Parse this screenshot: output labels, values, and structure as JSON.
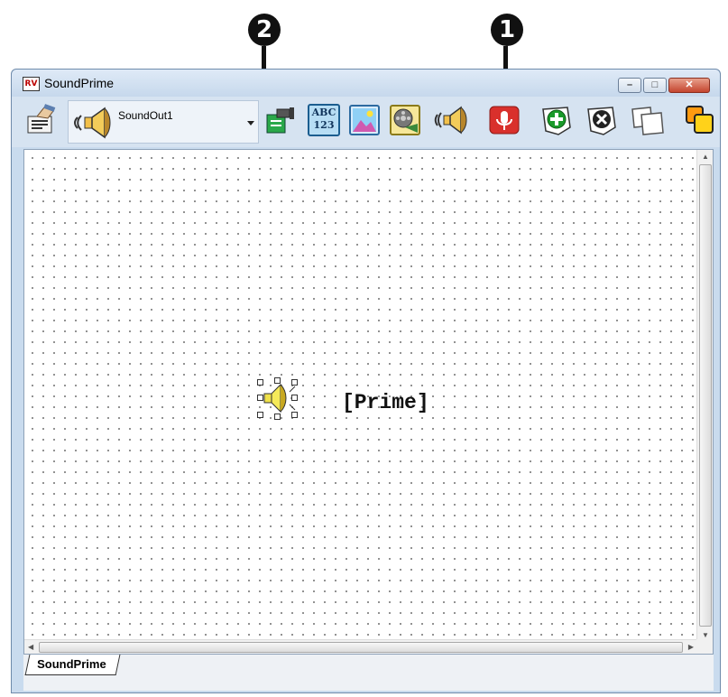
{
  "callouts": {
    "one": "1",
    "two": "2"
  },
  "window": {
    "title": "SoundPrime",
    "app_icon_text": "RV",
    "controls": {
      "minimize": "–",
      "maximize": "□",
      "close": "✕"
    }
  },
  "toolbar": {
    "sound_combo_value": "SoundOut1",
    "abc_line1": "ABC",
    "abc_line2": "123",
    "icons": [
      "properties-icon",
      "speaker-icon",
      "camera-sign-icon",
      "text-abc-icon",
      "picture-icon",
      "video-icon",
      "sound-output-icon",
      "microphone-icon",
      "add-icon",
      "remove-icon",
      "copy-icon",
      "bring-front-icon"
    ]
  },
  "canvas": {
    "label": "[Prime]"
  },
  "tabs": [
    {
      "label": "SoundPrime"
    }
  ],
  "colors": {
    "title_bg": "#c6d8ec",
    "mic_red": "#d9302c",
    "add_green": "#1a9a2a",
    "speaker_gold": "#e0b000"
  }
}
